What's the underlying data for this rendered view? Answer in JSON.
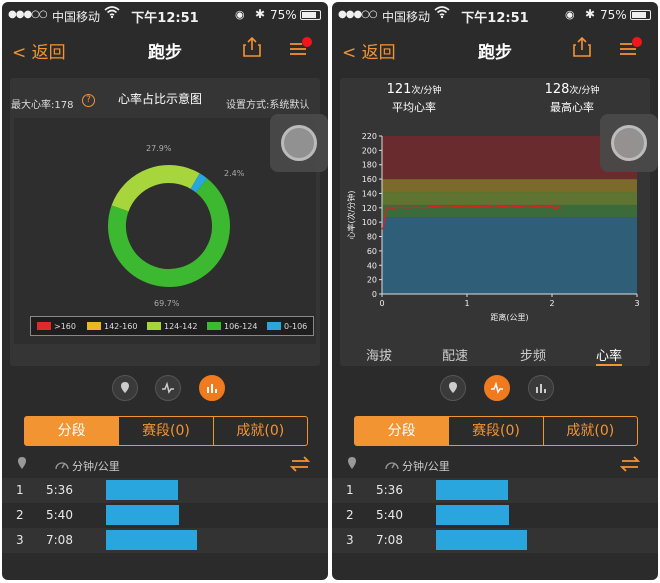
{
  "status": {
    "carrier": "中国移动",
    "time": "下午12:51",
    "battery": "75%"
  },
  "nav": {
    "back": "< 返回",
    "title": "跑步"
  },
  "left": {
    "max_hr": "最大心率:178",
    "help": "?",
    "chart_title": "心率占比示意图",
    "setting": "设置方式:系统默认",
    "donut": {
      "labels": [
        "27.9%",
        "2.4%",
        "69.7%"
      ]
    },
    "legend": [
      {
        "label": ">160",
        "color": "#e02a2a"
      },
      {
        "label": "142-160",
        "color": "#f0b427"
      },
      {
        "label": "124-142",
        "color": "#a6d63c"
      },
      {
        "label": "106-124",
        "color": "#3cb931"
      },
      {
        "label": "0-106",
        "color": "#2aa6df"
      }
    ]
  },
  "right": {
    "avg_value": "121",
    "avg_unit": "次/分钟",
    "avg_label": "平均心率",
    "max_value": "128",
    "max_unit": "次/分钟",
    "max_label": "最高心率",
    "ylabel": "心率(次/分钟)",
    "xlabel": "距离(公里)",
    "tabs": [
      "海拔",
      "配速",
      "步频",
      "心率"
    ]
  },
  "segments": {
    "tabs": [
      "分段",
      "赛段(0)",
      "成就(0)"
    ],
    "pace_header": "分钟/公里",
    "rows": [
      {
        "index": "1",
        "pace": "5:36",
        "level": 0.22
      },
      {
        "index": "2",
        "pace": "5:40",
        "level": 0.225
      },
      {
        "index": "3",
        "pace": "7:08",
        "level": 0.28
      }
    ]
  },
  "chart_data": [
    {
      "type": "pie",
      "title": "心率占比示意图",
      "categories": [
        ">160",
        "142-160",
        "124-142",
        "106-124",
        "0-106"
      ],
      "values": [
        0,
        0,
        27.9,
        69.7,
        2.4
      ],
      "colors": [
        "#e02a2a",
        "#f0b427",
        "#a6d63c",
        "#3cb931",
        "#2aa6df"
      ],
      "legend": "bottom"
    },
    {
      "type": "line",
      "xlabel": "距离(公里)",
      "ylabel": "心率(次/分钟)",
      "xlim": [
        0,
        3
      ],
      "ylim": [
        0,
        220
      ],
      "xticks": [
        0,
        1,
        2,
        3
      ],
      "yticks": [
        0,
        20,
        40,
        60,
        80,
        100,
        120,
        140,
        160,
        180,
        200,
        220
      ],
      "zones": [
        {
          "from": 0,
          "to": 106,
          "color": "#2f5e78"
        },
        {
          "from": 106,
          "to": 124,
          "color": "#3b6b3a"
        },
        {
          "from": 124,
          "to": 142,
          "color": "#5f7430"
        },
        {
          "from": 142,
          "to": 160,
          "color": "#7c6a2a"
        },
        {
          "from": 160,
          "to": 220,
          "color": "#6a2b2e"
        }
      ],
      "series": [
        {
          "color": "#e0201e",
          "x": [
            0.0,
            0.02,
            0.05,
            0.08,
            0.12,
            0.2,
            0.3,
            0.4,
            0.5,
            0.6,
            0.7,
            0.8,
            0.9,
            1.0,
            1.1,
            1.2,
            1.3,
            1.4,
            1.5,
            1.6,
            1.7,
            1.8,
            1.9,
            2.0,
            2.04,
            2.07,
            2.1
          ],
          "y": [
            90,
            95,
            118,
            121,
            119,
            121,
            120,
            121,
            120,
            122,
            121,
            121,
            122,
            121,
            122,
            121,
            123,
            122,
            121,
            122,
            123,
            122,
            121,
            122,
            118,
            122,
            119
          ]
        }
      ]
    }
  ]
}
